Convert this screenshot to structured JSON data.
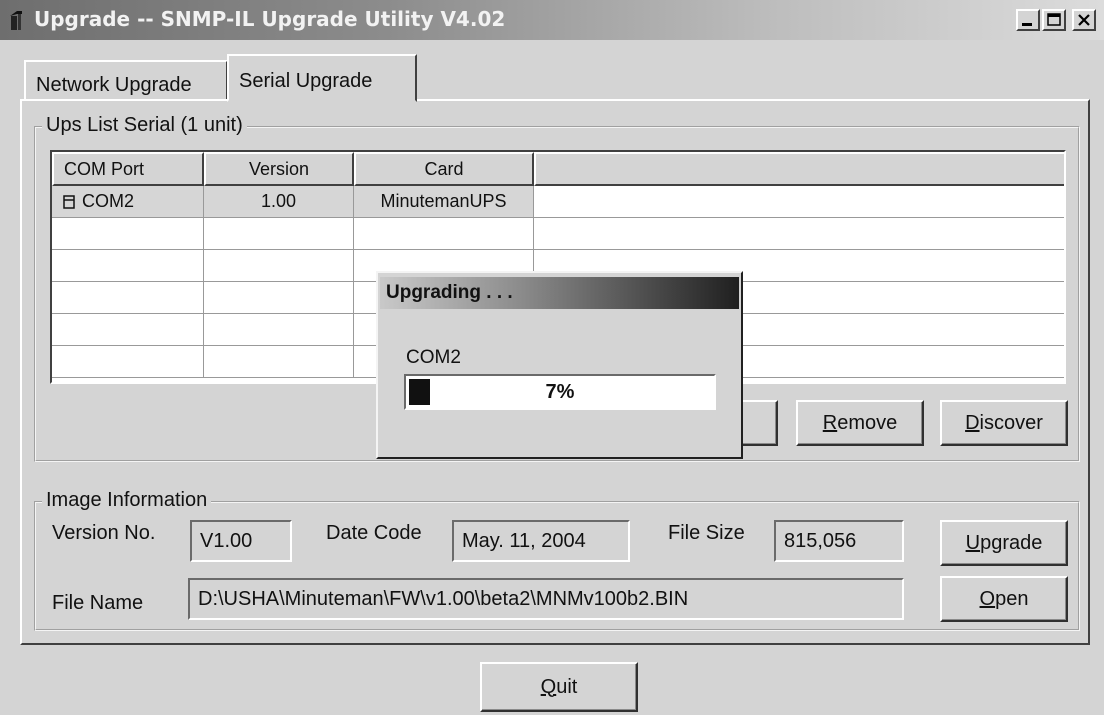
{
  "window": {
    "title": "Upgrade --  SNMP-IL Upgrade Utility V4.02",
    "controls": {
      "minimize": "minimize",
      "maximize": "maximize",
      "close": "close"
    }
  },
  "tabs": [
    {
      "label": "Network Upgrade",
      "active": false
    },
    {
      "label": "Serial Upgrade",
      "active": true
    }
  ],
  "ups_list": {
    "group_label": "Ups List Serial (1 unit)",
    "columns": [
      "COM Port",
      "Version",
      "Card",
      ""
    ],
    "rows": [
      {
        "com": "COM2",
        "version": "1.00",
        "card": "MinutemanUPS",
        "icon": "ups-device-icon"
      }
    ],
    "buttons": {
      "remove": "Remove",
      "discover": "Discover"
    }
  },
  "image_info": {
    "group_label": "Image Information",
    "version_label": "Version No.",
    "version_value": "V1.00",
    "date_label": "Date Code",
    "date_value": "May. 11, 2004",
    "size_label": "File Size",
    "size_value": "815,056",
    "file_label": "File Name",
    "file_value": "D:\\USHA\\Minuteman\\FW\\v1.00\\beta2\\MNMv100b2.BIN",
    "upgrade_button": "Upgrade",
    "open_button": "Open"
  },
  "quit_button": "Quit",
  "progress_dialog": {
    "title": "Upgrading . . .",
    "port": "COM2",
    "percent_text": "7%",
    "percent": 0.07
  },
  "colors": {
    "face": "#d4d4d4",
    "highlight": "#ffffff",
    "shadow": "#404040",
    "progress_fill": "#111111"
  }
}
